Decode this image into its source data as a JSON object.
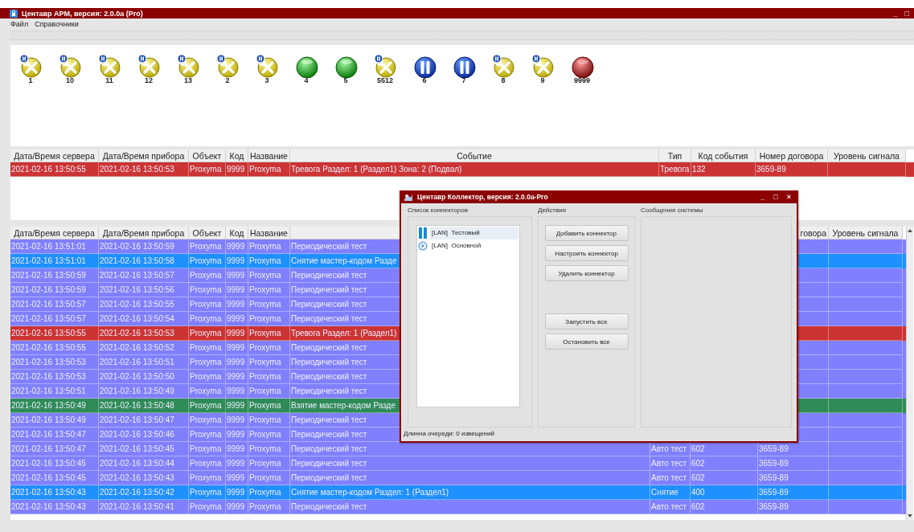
{
  "window": {
    "title": "Центавр АРМ, версия: 2.0.0a (Pro)",
    "controls": [
      "_",
      "□"
    ]
  },
  "menu": [
    "Файл",
    "Справочники"
  ],
  "devices": [
    {
      "label": "1",
      "kind": "service"
    },
    {
      "label": "10",
      "kind": "service"
    },
    {
      "label": "11",
      "kind": "service"
    },
    {
      "label": "12",
      "kind": "service"
    },
    {
      "label": "13",
      "kind": "service"
    },
    {
      "label": "2",
      "kind": "service"
    },
    {
      "label": "3",
      "kind": "service"
    },
    {
      "label": "4",
      "kind": "ok"
    },
    {
      "label": "5",
      "kind": "ok"
    },
    {
      "label": "5512",
      "kind": "service"
    },
    {
      "label": "6",
      "kind": "paused"
    },
    {
      "label": "7",
      "kind": "paused"
    },
    {
      "label": "8",
      "kind": "service"
    },
    {
      "label": "9",
      "kind": "service"
    },
    {
      "label": "9999",
      "kind": "alarm"
    }
  ],
  "alarm_table": {
    "columns": [
      "Дата/Время сервера",
      "Дата/Время прибора",
      "Объект",
      "Код",
      "Название",
      "Событие",
      "Тип",
      "Код события",
      "Номер договора",
      "Уровень сигнала"
    ],
    "rows": [
      {
        "color": "#cc3333",
        "cells": [
          "2021-02-16 13:50:55",
          "2021-02-16 13:50:53",
          "Proxyma",
          "9999",
          "Proxyma",
          "Тревога Раздел: 1 (Раздел1) Зона: 2 (Подвал)",
          "Тревога",
          "132",
          "3659-89"
        ]
      }
    ]
  },
  "event_table": {
    "columns": [
      "Дата/Время сервера",
      "Дата/Время прибора",
      "Объект",
      "Код",
      "Название",
      "говора",
      "Уровень сигнала"
    ],
    "rows": [
      {
        "color": "#8080ff",
        "cells": [
          "2021-02-16 13:51:01",
          "2021-02-16 13:50:59",
          "Proxyma",
          "9999",
          "Proxyma",
          "Периодический тест"
        ]
      },
      {
        "color": "#1e90ff",
        "cells": [
          "2021-02-16 13:51:01",
          "2021-02-16 13:50:58",
          "Proxyma",
          "9999",
          "Proxyma",
          "Снятие мастер-кодом Разде"
        ]
      },
      {
        "color": "#8080ff",
        "cells": [
          "2021-02-16 13:50:59",
          "2021-02-16 13:50:57",
          "Proxyma",
          "9999",
          "Proxyma",
          "Периодический тест"
        ]
      },
      {
        "color": "#8080ff",
        "cells": [
          "2021-02-16 13:50:59",
          "2021-02-16 13:50:56",
          "Proxyma",
          "9999",
          "Proxyma",
          "Периодический тест"
        ]
      },
      {
        "color": "#8080ff",
        "cells": [
          "2021-02-16 13:50:57",
          "2021-02-16 13:50:55",
          "Proxyma",
          "9999",
          "Proxyma",
          "Периодический тест"
        ]
      },
      {
        "color": "#8080ff",
        "cells": [
          "2021-02-16 13:50:57",
          "2021-02-16 13:50:54",
          "Proxyma",
          "9999",
          "Proxyma",
          "Периодический тест"
        ]
      },
      {
        "color": "#cc3333",
        "cells": [
          "2021-02-16 13:50:55",
          "2021-02-16 13:50:53",
          "Proxyma",
          "9999",
          "Proxyma",
          "Тревога Раздел: 1 (Раздел1)"
        ]
      },
      {
        "color": "#8080ff",
        "cells": [
          "2021-02-16 13:50:55",
          "2021-02-16 13:50:52",
          "Proxyma",
          "9999",
          "Proxyma",
          "Периодический тест"
        ]
      },
      {
        "color": "#8080ff",
        "cells": [
          "2021-02-16 13:50:53",
          "2021-02-16 13:50:51",
          "Proxyma",
          "9999",
          "Proxyma",
          "Периодический тест"
        ]
      },
      {
        "color": "#8080ff",
        "cells": [
          "2021-02-16 13:50:53",
          "2021-02-16 13:50:50",
          "Proxyma",
          "9999",
          "Proxyma",
          "Периодический тест"
        ]
      },
      {
        "color": "#8080ff",
        "cells": [
          "2021-02-16 13:50:51",
          "2021-02-16 13:50:49",
          "Proxyma",
          "9999",
          "Proxyma",
          "Периодический тест"
        ]
      },
      {
        "color": "#2e8b57",
        "cells": [
          "2021-02-16 13:50:49",
          "2021-02-16 13:50:48",
          "Proxyma",
          "9999",
          "Proxyma",
          "Взятие мастер-кодом Разде"
        ]
      },
      {
        "color": "#8080ff",
        "cells": [
          "2021-02-16 13:50:49",
          "2021-02-16 13:50:47",
          "Proxyma",
          "9999",
          "Proxyma",
          "Периодический тест"
        ]
      },
      {
        "color": "#8080ff",
        "cells": [
          "2021-02-16 13:50:47",
          "2021-02-16 13:50:46",
          "Proxyma",
          "9999",
          "Proxyma",
          "Периодический тест"
        ]
      },
      {
        "color": "#8080ff",
        "cells": [
          "2021-02-16 13:50:47",
          "2021-02-16 13:50:45",
          "Proxyma",
          "9999",
          "Proxyma",
          "Периодический тест",
          "Авто тест",
          "602",
          "3659-89"
        ]
      },
      {
        "color": "#8080ff",
        "cells": [
          "2021-02-16 13:50:45",
          "2021-02-16 13:50:44",
          "Proxyma",
          "9999",
          "Proxyma",
          "Периодический тест",
          "Авто тест",
          "602",
          "3659-89"
        ]
      },
      {
        "color": "#8080ff",
        "cells": [
          "2021-02-16 13:50:45",
          "2021-02-16 13:50:43",
          "Proxyma",
          "9999",
          "Proxyma",
          "Периодический тест",
          "Авто тест",
          "602",
          "3659-89"
        ]
      },
      {
        "color": "#1e90ff",
        "cells": [
          "2021-02-16 13:50:43",
          "2021-02-16 13:50:42",
          "Proxyma",
          "9999",
          "Proxyma",
          "Снятие мастер-кодом Раздел: 1 (Раздел1)",
          "Снятие",
          "400",
          "3659-89"
        ]
      },
      {
        "color": "#8080ff",
        "cells": [
          "2021-02-16 13:50:43",
          "2021-02-16 13:50:41",
          "Proxyma",
          "9999",
          "Proxyma",
          "Периодический тест",
          "Авто тест",
          "602",
          "3659-89"
        ]
      }
    ]
  },
  "dialog": {
    "title": "Центавр Коллектор, версия: 2.0.0a-Pro",
    "controls": [
      "_",
      "□",
      "×"
    ],
    "connectors_label": "Список коннекторов",
    "connectors": [
      {
        "label": "[LAN]  Тестовый",
        "kind": "paused",
        "selected": true
      },
      {
        "label": "[LAN]  Основной",
        "kind": "running",
        "selected": false
      }
    ],
    "actions_label": "Действия",
    "buttons": [
      "Добавить коннектор",
      "Настроить коннектор",
      "Удалить коннектор",
      "Запустить все",
      "Остановить все"
    ],
    "messages_label": "Сообщения системы",
    "status": "Длинна очереди: 0 извещений"
  }
}
